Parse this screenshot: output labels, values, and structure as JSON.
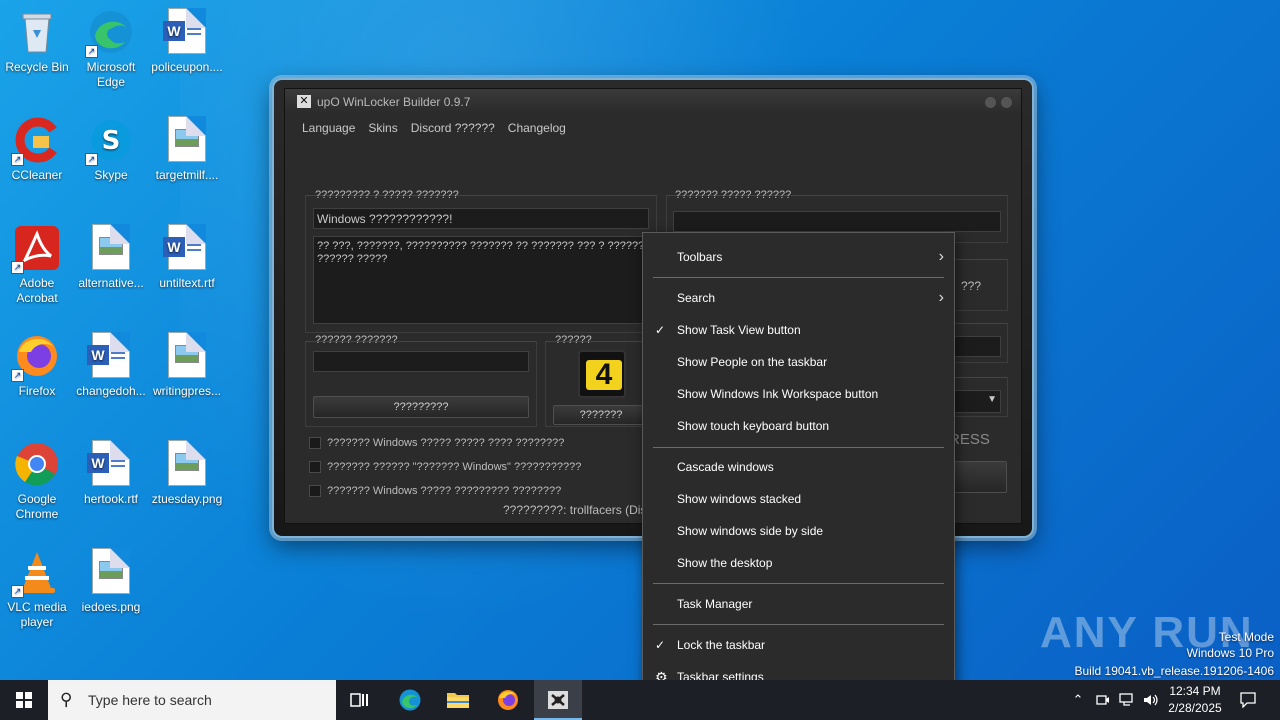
{
  "desktop": {
    "icons": [
      {
        "label": "Recycle Bin"
      },
      {
        "label": "Microsoft Edge"
      },
      {
        "label": "policeupon...."
      },
      {
        "label": "CCleaner"
      },
      {
        "label": "Skype"
      },
      {
        "label": "targetmilf...."
      },
      {
        "label": "Adobe Acrobat"
      },
      {
        "label": "alternative..."
      },
      {
        "label": "untiltext.rtf"
      },
      {
        "label": "Firefox"
      },
      {
        "label": "changedoh..."
      },
      {
        "label": "writingpres..."
      },
      {
        "label": "Google Chrome"
      },
      {
        "label": "hertook.rtf"
      },
      {
        "label": "ztuesday.png"
      },
      {
        "label": "VLC media player"
      },
      {
        "label": "iedoes.png"
      }
    ]
  },
  "app": {
    "title": "upO WinLocker Builder 0.9.7",
    "menu": [
      "Language",
      "Skins",
      "Discord ??????",
      "Changelog"
    ],
    "group_message_label": "????????? ? ????? ???????",
    "message_title_value": "Windows ????????????!",
    "message_body_value": "?? ???, ???????, ?????????? ??????? ?? ??????? ??? ? ?????? ?????? ?????",
    "group_right_label": "??????? ????? ??????",
    "right_partial_text": "???",
    "right_partial_word": "RESS",
    "group_code_label": "?????? ???????",
    "code_button": "?????????",
    "group_icon_label": "??????",
    "icon_button": "???????",
    "checkboxes": [
      "??????? Windows ????? ????? ???? ????????",
      "??????? ?????? \"??????? Windows\" ???????????",
      "??????? Windows ????? ????????? ????????"
    ],
    "footer": "?????????: trollfacers (Dis"
  },
  "context_menu": {
    "items": [
      {
        "label": "Toolbars",
        "submenu": true,
        "checked": false
      },
      {
        "label": "Search",
        "submenu": true,
        "checked": false
      },
      {
        "label": "Show Task View button",
        "submenu": false,
        "checked": true
      },
      {
        "label": "Show People on the taskbar",
        "submenu": false,
        "checked": false
      },
      {
        "label": "Show Windows Ink Workspace button",
        "submenu": false,
        "checked": false
      },
      {
        "label": "Show touch keyboard button",
        "submenu": false,
        "checked": false
      },
      {
        "label": "Cascade windows",
        "submenu": false,
        "checked": false
      },
      {
        "label": "Show windows stacked",
        "submenu": false,
        "checked": false
      },
      {
        "label": "Show windows side by side",
        "submenu": false,
        "checked": false
      },
      {
        "label": "Show the desktop",
        "submenu": false,
        "checked": false
      },
      {
        "label": "Task Manager",
        "submenu": false,
        "checked": false
      },
      {
        "label": "Lock the taskbar",
        "submenu": false,
        "checked": true
      },
      {
        "label": "Taskbar settings",
        "submenu": false,
        "checked": false
      }
    ],
    "check_glyph": "✓",
    "arrow_glyph": "›",
    "gear_glyph": "⚙"
  },
  "watermark": {
    "logo": "ANY RUN",
    "lines": [
      "Test Mode",
      "Windows 10 Pro",
      "Build 19041.vb_release.191206-1406"
    ]
  },
  "taskbar": {
    "search_placeholder": "Type here to search",
    "time": "12:34 PM",
    "date": "2/28/2025",
    "apps": [
      "task-view-icon",
      "edge-icon",
      "file-explorer-icon",
      "firefox-icon",
      "winlocker-icon"
    ]
  },
  "colors": {
    "desktop_blue": "#0a7fd6",
    "menu_bg": "#2b2b2b",
    "taskbar_bg": "#1c2026",
    "window_border": "#7fb3d8"
  }
}
